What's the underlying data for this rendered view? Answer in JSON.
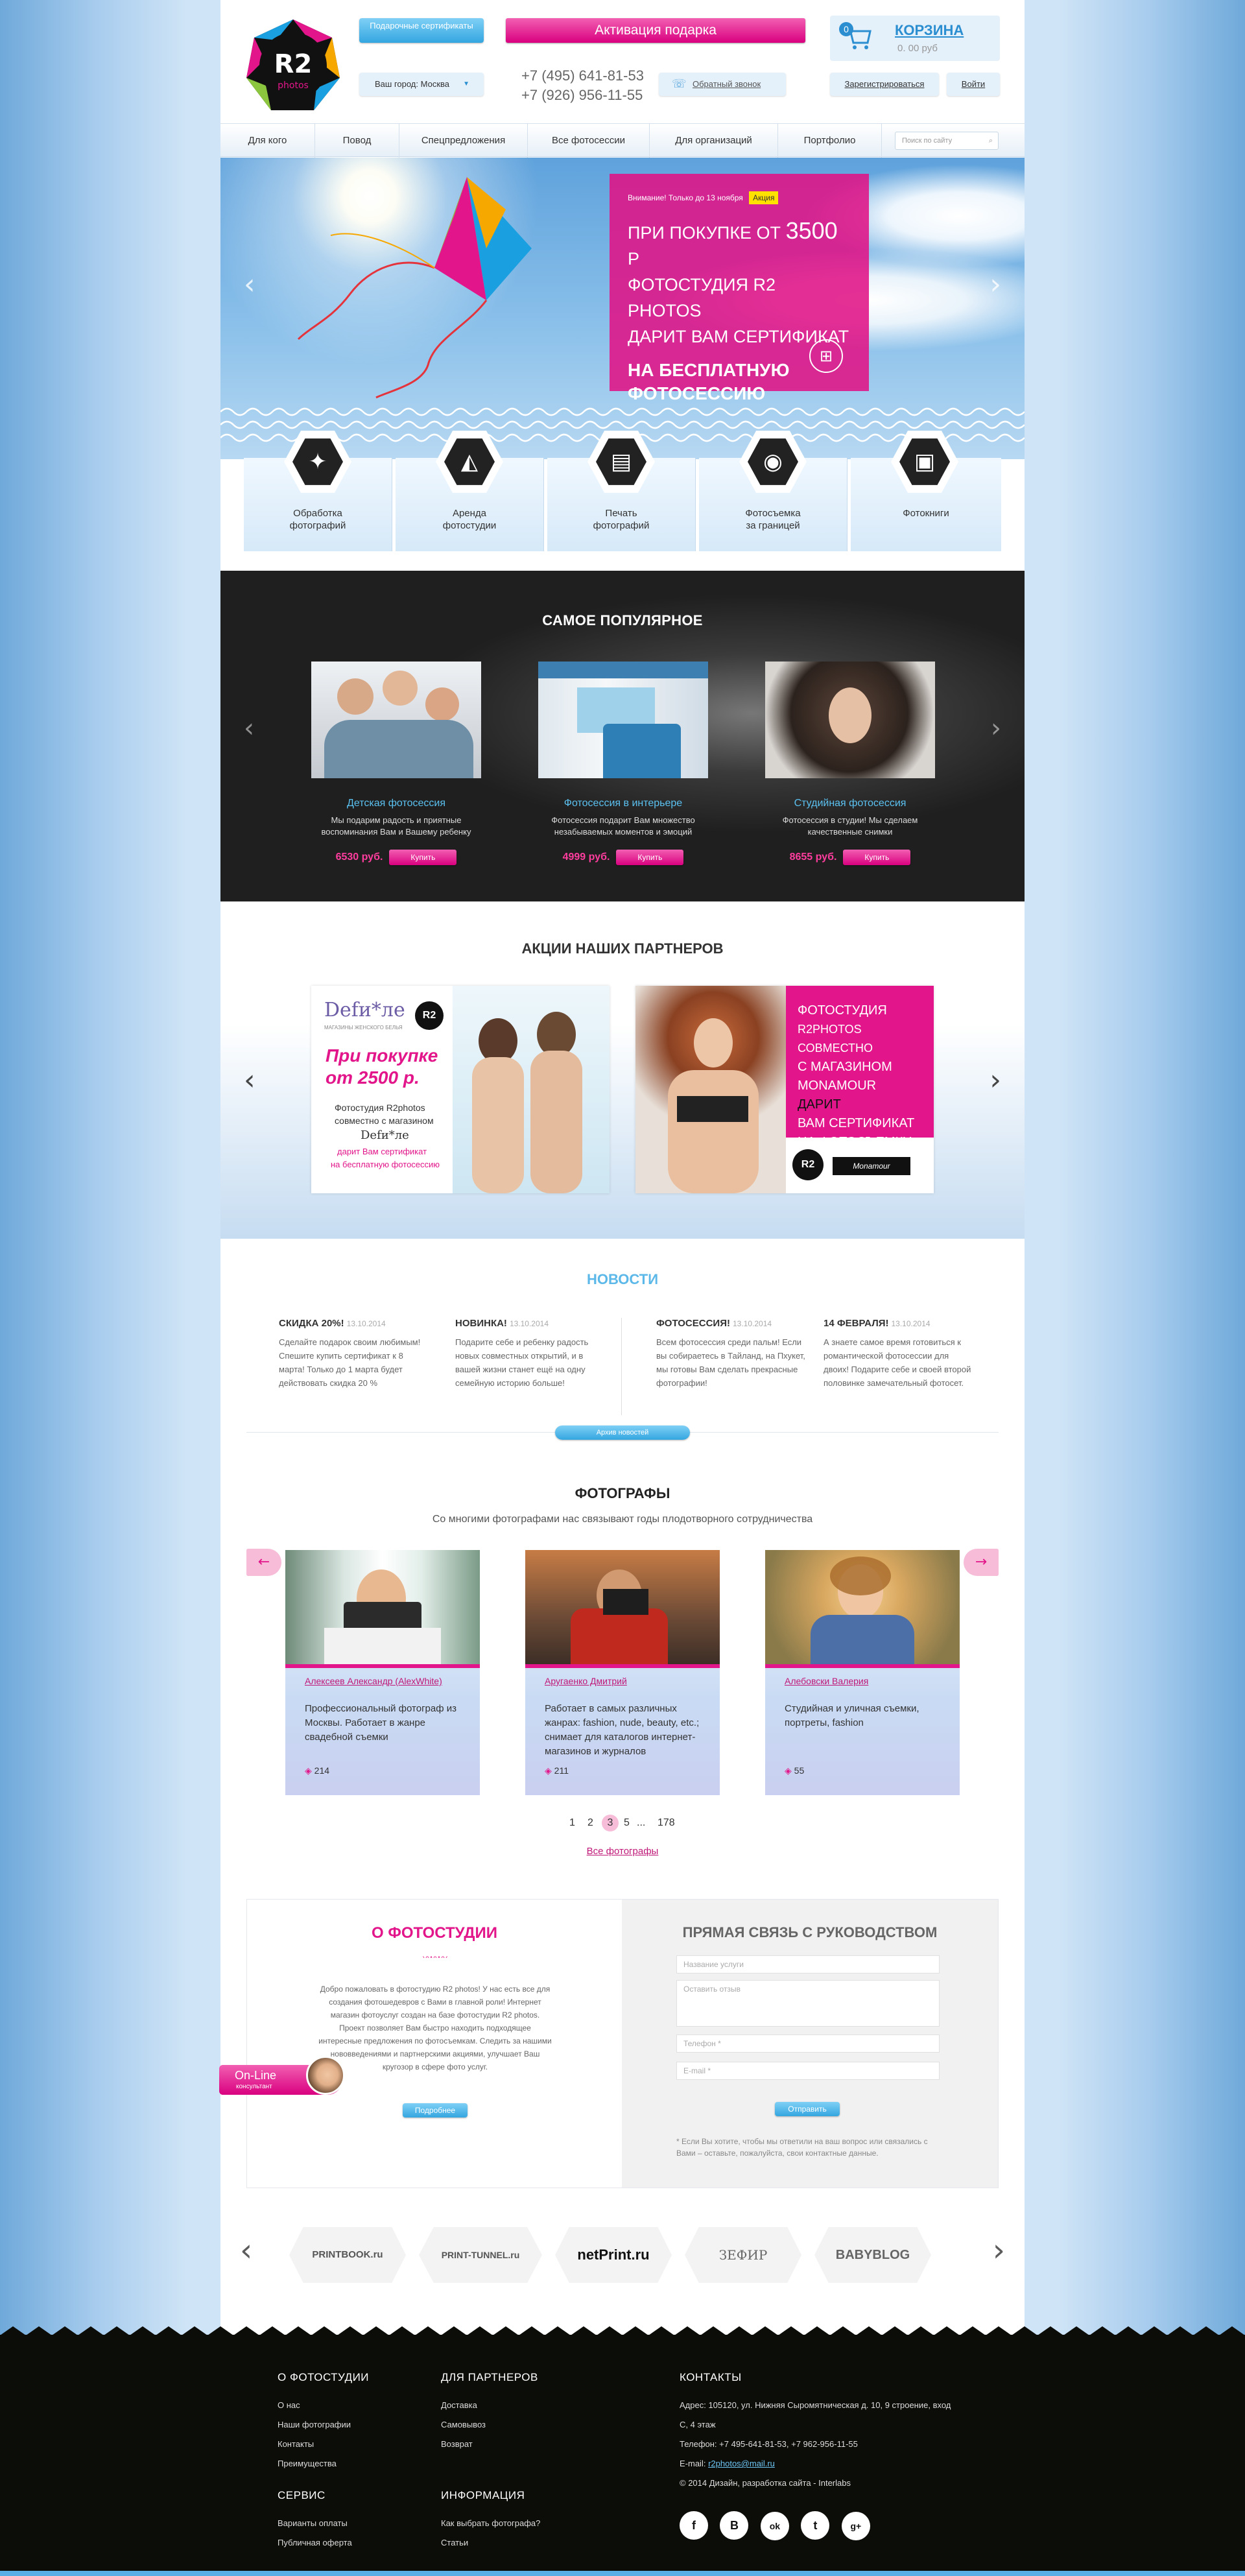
{
  "header": {
    "logo_text": "R2",
    "logo_sub": "photos",
    "gift_certificates": "Подарочные сертификаты",
    "gift_activation": "Активация подарка",
    "city": "Ваш город: Москва",
    "phone1": "+7 (495) 641-81-53",
    "phone2": "+7 (926) 956-11-55",
    "callback": "Обратный звонок",
    "cart_title": "КОРЗИНА",
    "cart_count": "0",
    "cart_sum": "0. 00 руб",
    "register": "Зарегистрироваться",
    "login": "Войти"
  },
  "menu": [
    "Для кого",
    "Повод",
    "Спецпредложения",
    "Все фотосессии",
    "Для организаций",
    "Портфолио"
  ],
  "search_placeholder": "Поиск по сайту",
  "hero": {
    "notice": "Внимание! Только до 13 ноября",
    "badge": "Акция",
    "line1": "ПРИ ПОКУПКЕ ОТ",
    "amount": "3500",
    "currency": "Р",
    "line2": "ФОТОСТУДИЯ R2 PHOTOS",
    "line3": "ДАРИТ ВАМ СЕРТИФИКАТ",
    "line4": "НА БЕСПЛАТНУЮ",
    "line5": "ФОТОСЕССИЮ"
  },
  "services": [
    {
      "l1": "Обработка",
      "l2": "фотографий",
      "icon": "wand-icon",
      "glyph": "✦"
    },
    {
      "l1": "Аренда",
      "l2": "фотостудии",
      "icon": "studio-light-icon",
      "glyph": "◭"
    },
    {
      "l1": "Печать",
      "l2": "фотографий",
      "icon": "printer-icon",
      "glyph": "▤"
    },
    {
      "l1": "Фотосъемка",
      "l2": "за границей",
      "icon": "globe-palm-icon",
      "glyph": "◉"
    },
    {
      "l1": "Фотокниги",
      "l2": "",
      "icon": "photobook-icon",
      "glyph": "▣"
    }
  ],
  "popular": {
    "title": "САМОЕ ПОПУЛЯРНОЕ",
    "items": [
      {
        "title": "Детская фотосессия",
        "desc": "Мы подарим радость и приятные воспоминания Вам и Вашему ребенку",
        "price": "6530 руб.",
        "buy": "Купить"
      },
      {
        "title": "Фотосессия в интерьере",
        "desc": "Фотосессия подарит Вам множество незабываемых моментов  и эмоций",
        "price": "4999 руб.",
        "buy": "Купить"
      },
      {
        "title": "Студийная фотосессия",
        "desc": "Фотосессия в студии! Мы сделаем качественные снимки",
        "price": "8655 руб.",
        "buy": "Купить"
      }
    ]
  },
  "partners": {
    "title": "АКЦИИ НАШИХ ПАРТНЕРОВ",
    "b1": {
      "brand": "Defи*ле",
      "brand_sub": "МАГАЗИНЫ ЖЕНСКОГО БЕЛЬЯ",
      "offer1": "При покупке",
      "offer2": "от 2500 р.",
      "t1": "Фотостудия R2photos",
      "t2": "совместно с магазином",
      "t3": "Defи*ле",
      "t4": "дарит Вам сертификат",
      "t5": "на бесплатную фотосессию"
    },
    "b2": {
      "l1": "ФОТОСТУДИЯ",
      "l2": "R2PHOTOS СОВМЕСТНО",
      "l3": "С МАГАЗИНОМ",
      "l4": "MONAMOUR",
      "l5": "ДАРИТ",
      "l6": "ВАМ СЕРТИФИКАТ",
      "l7": "НА ФОТОСЪЕМКУ",
      "brand": "Monamour"
    }
  },
  "news": {
    "title": "НОВОСТИ",
    "items": [
      {
        "title": "СКИДКА 20%!",
        "date": "13.10.2014",
        "text": "Сделайте подарок своим любимым! Спешите купить сертификат к 8 марта! Только до 1 марта будет действовать скидка 20 %"
      },
      {
        "title": "НОВИНКА!",
        "date": "13.10.2014",
        "text": "Подарите себе и ребенку радость новых совместных открытий, и  в вашей жизни станет ещё на одну семейную историю больше!"
      },
      {
        "title": "ФОТОСЕССИЯ!",
        "date": "13.10.2014",
        "text": "Всем фотосессия среди пальм! Если вы собираетесь в Тайланд, на Пхукет, мы готовы Вам сделать прекрасные фотографии!"
      },
      {
        "title": "14 ФЕВРАЛЯ!",
        "date": "13.10.2014",
        "text": "А знаете самое время готовиться к романтической фотосессии для двоих! Подарите себе и своей второй половинке замечательный фотосет."
      }
    ],
    "archive": "Архив новостей"
  },
  "photographers": {
    "title": "ФОТОГРАФЫ",
    "subtitle": "Со многими фотографами нас связывают годы плодотворного сотрудничества",
    "items": [
      {
        "name": "Алексеев Александр (AlexWhite)",
        "desc": "Профессиональный фотограф из Москвы. Работает в жанре свадебной съемки",
        "count": "214"
      },
      {
        "name": "Аругаенко Дмитрий",
        "desc": "Работает в самых различных жанрах: fashion, nude, beauty, etc.; снимает для каталогов интернет-магазинов и журналов",
        "count": "211"
      },
      {
        "name": "Алебовски Валерия",
        "desc": "Студийная и уличная съемки, портреты, fashion",
        "count": "55"
      }
    ],
    "pages": [
      "1",
      "2",
      "3",
      "5",
      "...",
      "178"
    ],
    "all": "Все фотографы"
  },
  "about": {
    "title": "О ФОТОСТУДИИ",
    "text": "Добро пожаловать в фотостудию R2 photos! У нас есть все для создания фотошедевров с Вами в главной роли! Интернет магазин фотоуслуг создан на базе фотостудии R2 photos.  Проект позволяет Вам быстро находить подходящее интересные предложения по фотосъемкам. Следить за нашими нововведениями и партнерскими акциями, улучшает Ваш кругозор в сфере фото услуг.",
    "more": "Подробнее",
    "online": "On-Line",
    "online_sub": "консультант"
  },
  "contact": {
    "title": "ПРЯМАЯ СВЯЗЬ С РУКОВОДСТВОМ",
    "f_service": "Название услуги",
    "f_review": "Оставить отзыв",
    "f_phone": "Телефон *",
    "f_email": "E-mail *",
    "send": "Отправить",
    "note": "* Если Вы хотите, чтобы мы ответили на ваш вопрос или связались с Вами – оставьте, пожалуйста, свои контактные данные."
  },
  "brands": [
    "PRINTBOOK.ru",
    "PRINT-TUNNEL.ru",
    "netPrint.ru",
    "ЗЕФИР",
    "BABYBLOG"
  ],
  "footer": {
    "about_title": "О ФОТОСТУДИИ",
    "about_links": [
      "О нас",
      "Наши фотографии",
      "Контакты",
      "Преимущества"
    ],
    "partners_title": "ДЛЯ ПАРТНЕРОВ",
    "partners_links": [
      "Доставка",
      "Самовывоз",
      "Возврат"
    ],
    "service_title": "СЕРВИС",
    "service_links": [
      "Варианты оплаты",
      "Публичная оферта"
    ],
    "info_title": "ИНФОРМАЦИЯ",
    "info_links": [
      "Как выбрать фотографа?",
      "Статьи"
    ],
    "contacts_title": "КОНТАКТЫ",
    "address": "Адрес: 105120, ул. Нижняя Сыромятническая д. 10, 9 строение, вход С, 4 этаж",
    "phones": "Телефон: +7 495-641-81-53, +7 962-956-11-55",
    "email_label": "E-mail:",
    "email": "r2photos@mail.ru",
    "copyright": "© 2014 Дизайн, разработка сайта - Interlabs",
    "social": [
      "f",
      "В",
      "ok",
      "t",
      "g+"
    ]
  },
  "colors": {
    "accent_pink": "#e2168a",
    "accent_blue": "#34a6e0",
    "dark": "#0c0c08"
  }
}
